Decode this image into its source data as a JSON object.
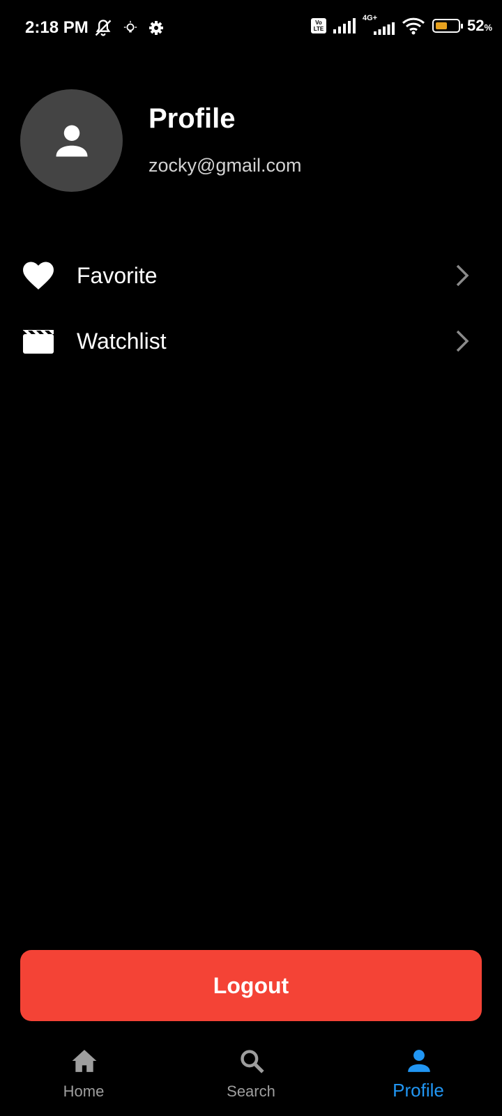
{
  "status_bar": {
    "time": "2:18 PM",
    "network_type": "4G+",
    "volte_top": "Vo",
    "volte_bottom": "LTE",
    "battery_percent": "52",
    "battery_unit": "%",
    "battery_level": 0.52,
    "battery_color": "#e6a11f"
  },
  "profile": {
    "title": "Profile",
    "email": "zocky@gmail.com"
  },
  "menu": [
    {
      "label": "Favorite",
      "icon": "heart-icon"
    },
    {
      "label": "Watchlist",
      "icon": "clapperboard-icon"
    }
  ],
  "logout_label": "Logout",
  "colors": {
    "accent": "#2196f3",
    "danger": "#f44336",
    "avatar_bg": "#444444",
    "inactive": "#9e9e9e"
  },
  "bottom_nav": {
    "items": [
      {
        "label": "Home",
        "icon": "home-icon",
        "active": false
      },
      {
        "label": "Search",
        "icon": "search-icon",
        "active": false
      },
      {
        "label": "Profile",
        "icon": "person-icon",
        "active": true
      }
    ]
  }
}
